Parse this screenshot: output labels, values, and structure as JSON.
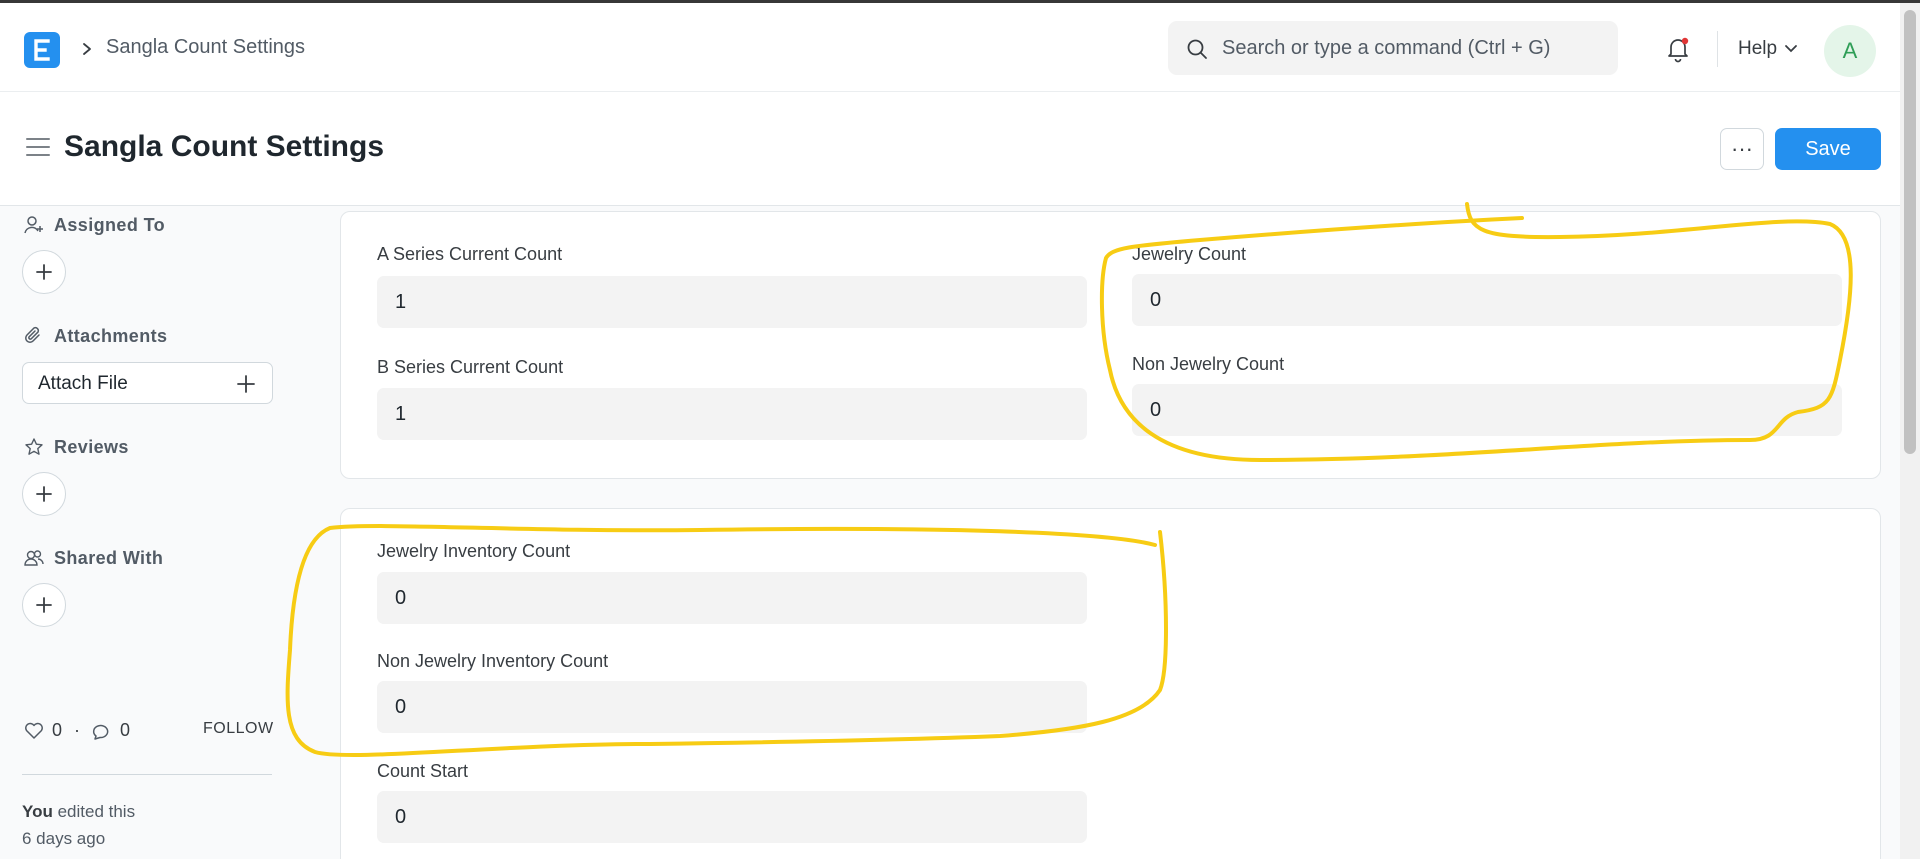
{
  "navbar": {
    "breadcrumb": "Sangla Count Settings",
    "search_placeholder": "Search or type a command (Ctrl + G)",
    "help_label": "Help",
    "avatar_initial": "A"
  },
  "page": {
    "title": "Sangla Count Settings",
    "more_label": "···",
    "save_label": "Save"
  },
  "sidebar": {
    "assigned_to": "Assigned To",
    "attachments": "Attachments",
    "attach_file": "Attach File",
    "reviews": "Reviews",
    "shared_with": "Shared With",
    "likes": "0",
    "comments": "0",
    "follow": "FOLLOW",
    "activity_user": "You",
    "activity_action": " edited this",
    "activity_time": "6 days ago"
  },
  "section1": {
    "a_series_label": "A Series Current Count",
    "a_series_value": "1",
    "b_series_label": "B Series Current Count",
    "b_series_value": "1",
    "jewelry_label": "Jewelry Count",
    "jewelry_value": "0",
    "non_jewelry_label": "Non Jewelry Count",
    "non_jewelry_value": "0"
  },
  "section2": {
    "jewelry_inventory_label": "Jewelry Inventory Count",
    "jewelry_inventory_value": "0",
    "non_jewelry_inventory_label": "Non Jewelry Inventory Count",
    "non_jewelry_inventory_value": "0",
    "count_start_label": "Count Start",
    "count_start_value": "0"
  },
  "colors": {
    "accent": "#2490ef",
    "annotation": "#f7cc14"
  }
}
